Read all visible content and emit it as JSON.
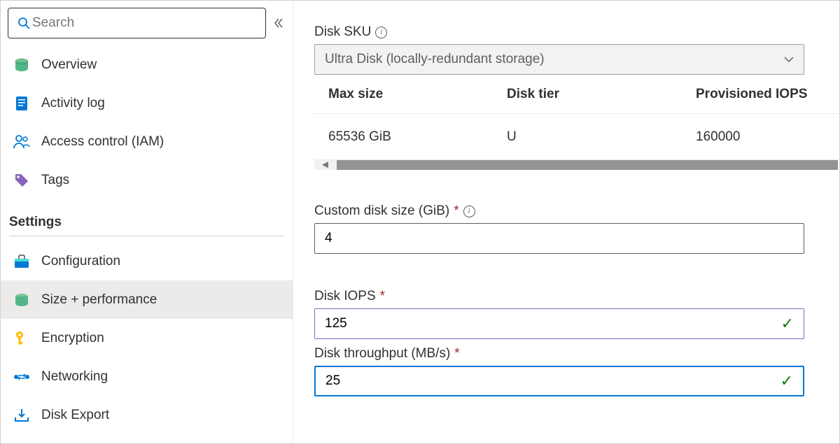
{
  "search": {
    "placeholder": "Search"
  },
  "nav": {
    "overview": "Overview",
    "activity": "Activity log",
    "iam": "Access control (IAM)",
    "tags": "Tags"
  },
  "settings": {
    "header": "Settings",
    "config": "Configuration",
    "size": "Size + performance",
    "encryption": "Encryption",
    "networking": "Networking",
    "export": "Disk Export"
  },
  "main": {
    "sku_label": "Disk SKU",
    "sku_value": "Ultra Disk (locally-redundant storage)",
    "table": {
      "h1": "Max size",
      "h2": "Disk tier",
      "h3": "Provisioned IOPS",
      "r1c1": "65536 GiB",
      "r1c2": "U",
      "r1c3": "160000"
    },
    "custom_size_label": "Custom disk size (GiB)",
    "custom_size_value": "4",
    "iops_label": "Disk IOPS",
    "iops_value": "125",
    "throughput_label": "Disk throughput (MB/s)",
    "throughput_value": "25"
  }
}
